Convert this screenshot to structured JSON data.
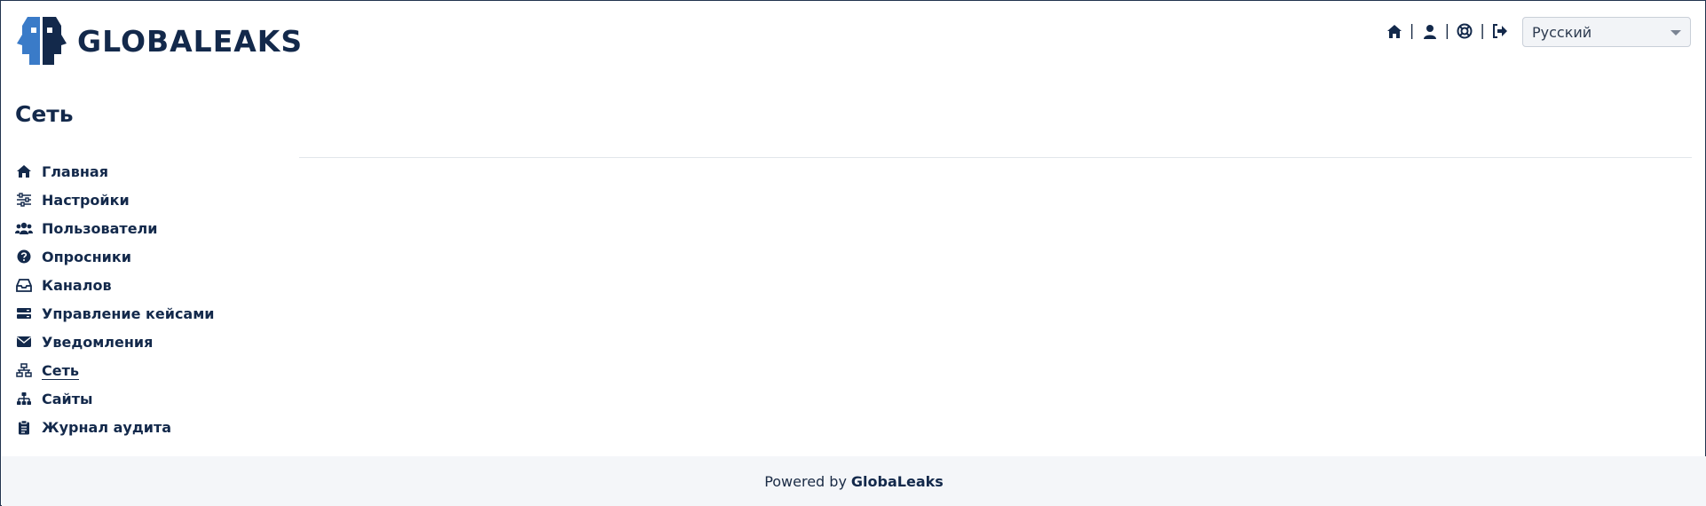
{
  "brand": {
    "name": "GLOBALEAKS",
    "primary_color": "#13294b",
    "accent_color": "#3a7bc8"
  },
  "top_nav": {
    "items": [
      {
        "icon": "home-icon"
      },
      {
        "icon": "user-icon"
      },
      {
        "icon": "lifebuoy-icon"
      },
      {
        "icon": "logout-icon"
      }
    ],
    "separator": "|"
  },
  "language_select": {
    "value": "Русский"
  },
  "page": {
    "title": "Сеть"
  },
  "sidebar": {
    "items": [
      {
        "label": "Главная",
        "icon": "home-icon"
      },
      {
        "label": "Настройки",
        "icon": "sliders-icon"
      },
      {
        "label": "Пользователи",
        "icon": "users-icon"
      },
      {
        "label": "Опросники",
        "icon": "question-circle-icon"
      },
      {
        "label": "Каналов",
        "icon": "inbox-icon"
      },
      {
        "label": "Управление кейсами",
        "icon": "server-icon"
      },
      {
        "label": "Уведомления",
        "icon": "envelope-icon"
      },
      {
        "label": "Сеть",
        "icon": "network-icon",
        "active": true
      },
      {
        "label": "Сайты",
        "icon": "sitemap-icon"
      },
      {
        "label": "Журнал аудита",
        "icon": "clipboard-icon"
      }
    ]
  },
  "footer": {
    "prefix": "Powered by",
    "brand": "GlobaLeaks"
  }
}
